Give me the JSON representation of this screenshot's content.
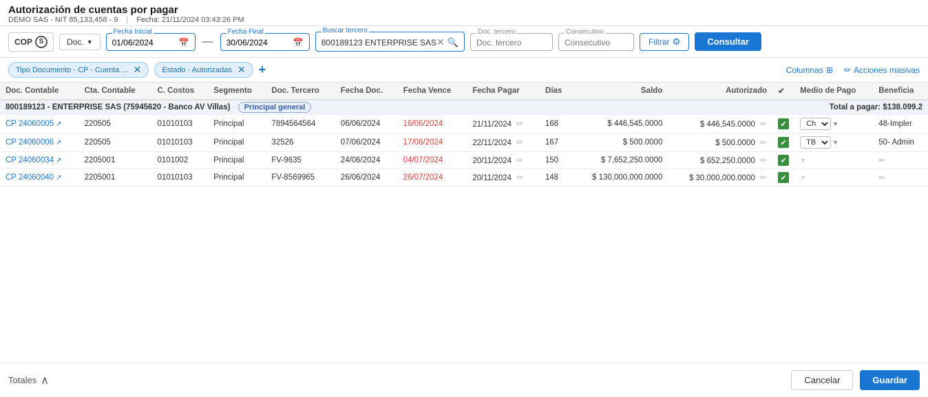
{
  "header": {
    "title": "Autorización de cuentas por pagar",
    "company": "DEMO SAS - NIT 85,133,458 - 9",
    "date_label": "Fecha:",
    "date_value": "21/11/2024 03:43:26 PM"
  },
  "toolbar": {
    "currency": "COP",
    "doc_label": "Doc.",
    "fecha_inicial_label": "Fecha Inicial",
    "fecha_inicial_value": "01/06/2024",
    "fecha_final_label": "Fecha Final",
    "fecha_final_value": "30/06/2024",
    "buscar_tercero_label": "Buscar tercero",
    "buscar_tercero_value": "800189123 ENTERPRISE SAS",
    "doc_tercero_placeholder": "Doc. tercero",
    "consecutivo_placeholder": "Consecutivo",
    "filtrar_label": "Filtrar",
    "consultar_label": "Consultar"
  },
  "filters": [
    {
      "id": "tipo_doc",
      "label": "Tipo Documento - CP - Cuenta ..."
    },
    {
      "id": "estado",
      "label": "Estado - Autorizadas"
    }
  ],
  "filters_bar": {
    "columnas_label": "Columnas",
    "acciones_label": "Acciones masivas"
  },
  "table": {
    "columns": [
      "Doc. Contable",
      "Cta. Contable",
      "C. Costos",
      "Segmento",
      "Doc. Tercero",
      "Fecha Doc.",
      "Fecha Vence",
      "Fecha Pagar",
      "Días",
      "Saldo",
      "Autorizado",
      "",
      "Medio de Pago",
      "Beneficia"
    ],
    "group": {
      "name": "800189123 - ENTERPRISE SAS (75945620 - Banco AV Villas)",
      "badge": "Principal general",
      "total": "Total a pagar: $138.099.2"
    },
    "rows": [
      {
        "doc_contable": "CP 24060005",
        "cta_contable": "220505",
        "c_costos": "01010103",
        "segmento": "Principal",
        "doc_tercero": "7894564564",
        "fecha_doc": "06/06/2024",
        "fecha_vence": "16/06/2024",
        "fecha_vence_red": true,
        "fecha_pagar": "21/11/2024",
        "dias": "168",
        "saldo": "$ 446,545.0000",
        "autorizado": "$ 446,545.0000",
        "checked": true,
        "medio_pago": "Ch",
        "beneficia": "48-Impler"
      },
      {
        "doc_contable": "CP 24060006",
        "cta_contable": "220505",
        "c_costos": "01010103",
        "segmento": "Principal",
        "doc_tercero": "32526",
        "fecha_doc": "07/06/2024",
        "fecha_vence": "17/06/2024",
        "fecha_vence_red": true,
        "fecha_pagar": "22/11/2024",
        "dias": "167",
        "saldo": "$ 500.0000",
        "autorizado": "$ 500.0000",
        "checked": true,
        "medio_pago": "TB",
        "beneficia": "50- Admin"
      },
      {
        "doc_contable": "CP 24060034",
        "cta_contable": "2205001",
        "c_costos": "0101002",
        "segmento": "Principal",
        "doc_tercero": "FV-9635",
        "fecha_doc": "24/06/2024",
        "fecha_vence": "04/07/2024",
        "fecha_vence_red": true,
        "fecha_pagar": "20/11/2024",
        "dias": "150",
        "saldo": "$ 7,652,250.0000",
        "autorizado": "$ 652,250.0000",
        "checked": true,
        "medio_pago": "",
        "beneficia": ""
      },
      {
        "doc_contable": "CP 24060040",
        "cta_contable": "2205001",
        "c_costos": "01010103",
        "segmento": "Principal",
        "doc_tercero": "FV-8569965",
        "fecha_doc": "26/06/2024",
        "fecha_vence": "26/07/2024",
        "fecha_vence_red": true,
        "fecha_pagar": "20/11/2024",
        "dias": "148",
        "saldo": "$ 130,000,000.0000",
        "autorizado": "$ 30,000,000.0000",
        "checked": true,
        "medio_pago": "",
        "beneficia": ""
      }
    ]
  },
  "footer": {
    "totales_label": "Totales",
    "cancel_label": "Cancelar",
    "guardar_label": "Guardar"
  }
}
